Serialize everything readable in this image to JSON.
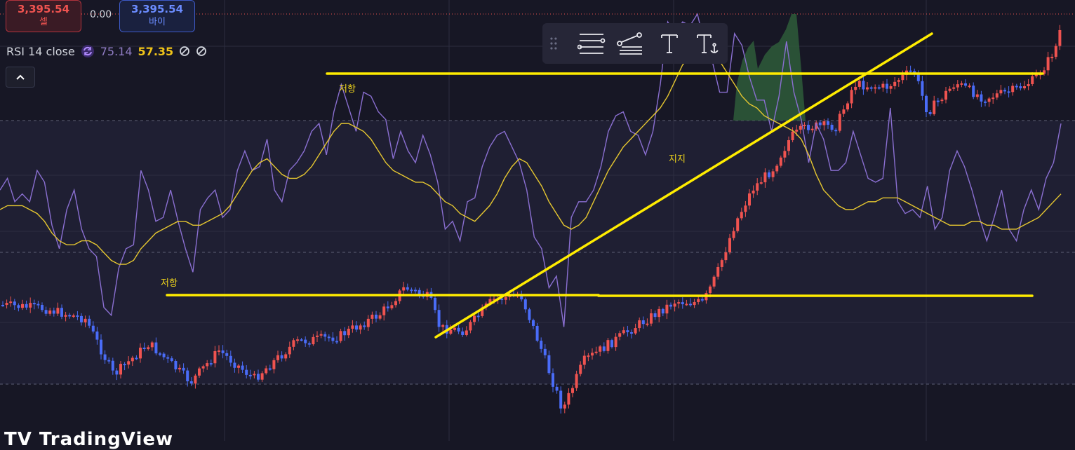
{
  "order_panel": {
    "sell_price": "3,395.54",
    "sell_label": "셀",
    "spread": "0.00",
    "buy_price": "3,395.54",
    "buy_label": "바이"
  },
  "indicator_legend": {
    "title": "RSI 14 close",
    "rsi_value": "75.14",
    "ma_value": "57.35"
  },
  "drawing_toolbar": {
    "tools": [
      "horizontal-lines-icon",
      "path-icon",
      "text-icon",
      "anchored-text-icon"
    ],
    "text_tool_glyph": "T"
  },
  "annotations": {
    "resistance_top": "저항",
    "support": "지지",
    "resistance_left": "저항"
  },
  "watermark": "TV TradingView",
  "colors": {
    "up": "#ef5350",
    "down": "#4a6cf7",
    "rsi_line": "#8a6fd1",
    "rsi_ma": "#e6c730",
    "trendline": "#ffec00",
    "background": "#171725"
  },
  "chart_data": {
    "type": "line",
    "series": [
      {
        "name": "RSI 14 close",
        "values": [
          55,
          58,
          52,
          54,
          52,
          60,
          57,
          46,
          40,
          50,
          55,
          45,
          40,
          38,
          25,
          23,
          35,
          40,
          41,
          60,
          55,
          47,
          48,
          55,
          47,
          40,
          34,
          50,
          53,
          55,
          48,
          50,
          60,
          65,
          60,
          61,
          68,
          55,
          52,
          60,
          62,
          65,
          70,
          72,
          64,
          75,
          82,
          76,
          70,
          80,
          79,
          75,
          73,
          63,
          70,
          65,
          62,
          69,
          64,
          57,
          45,
          47,
          42,
          52,
          53,
          61,
          66,
          69,
          70,
          66,
          62,
          55,
          43,
          40,
          30,
          33,
          20,
          48,
          52,
          52,
          55,
          61,
          70,
          74,
          75,
          70,
          69,
          64,
          70,
          82,
          98,
          95,
          98,
          97,
          100,
          92,
          88,
          80,
          80,
          95,
          92,
          84,
          78,
          78,
          70,
          79,
          93,
          80,
          73,
          62,
          72,
          68,
          60,
          60,
          62,
          70,
          64,
          58,
          57,
          58,
          76,
          52,
          49,
          50,
          48,
          56,
          45,
          48,
          60,
          65,
          61,
          55,
          48,
          42,
          48,
          55,
          45,
          42,
          50,
          55,
          50,
          58,
          62,
          72
        ]
      },
      {
        "name": "RSI MA",
        "values": [
          50,
          51,
          51,
          51,
          50,
          49,
          47,
          44,
          42,
          41,
          41,
          42,
          42,
          41,
          39,
          37,
          36,
          36,
          37,
          40,
          42,
          44,
          45,
          46,
          47,
          47,
          46,
          46,
          47,
          48,
          49,
          51,
          54,
          57,
          60,
          62,
          63,
          61,
          59,
          58,
          58,
          59,
          61,
          64,
          67,
          70,
          72,
          72,
          71,
          70,
          68,
          65,
          62,
          60,
          59,
          58,
          57,
          57,
          56,
          54,
          52,
          51,
          49,
          48,
          47,
          49,
          51,
          54,
          58,
          61,
          63,
          62,
          59,
          56,
          52,
          49,
          46,
          45,
          46,
          48,
          52,
          56,
          60,
          63,
          66,
          68,
          70,
          72,
          74,
          76,
          79,
          83,
          87,
          89,
          90,
          91,
          90,
          88,
          85,
          82,
          79,
          77,
          76,
          74,
          73,
          72,
          71,
          70,
          68,
          64,
          59,
          55,
          53,
          51,
          50,
          50,
          51,
          52,
          52,
          53,
          53,
          53,
          52,
          51,
          50,
          49,
          48,
          47,
          46,
          46,
          46,
          47,
          47,
          46,
          46,
          45,
          45,
          45,
          46,
          47,
          48,
          50,
          52,
          54
        ]
      }
    ],
    "price_levels": {
      "resistance_top": "저항",
      "support": "지지",
      "resistance_left": "저항"
    }
  }
}
